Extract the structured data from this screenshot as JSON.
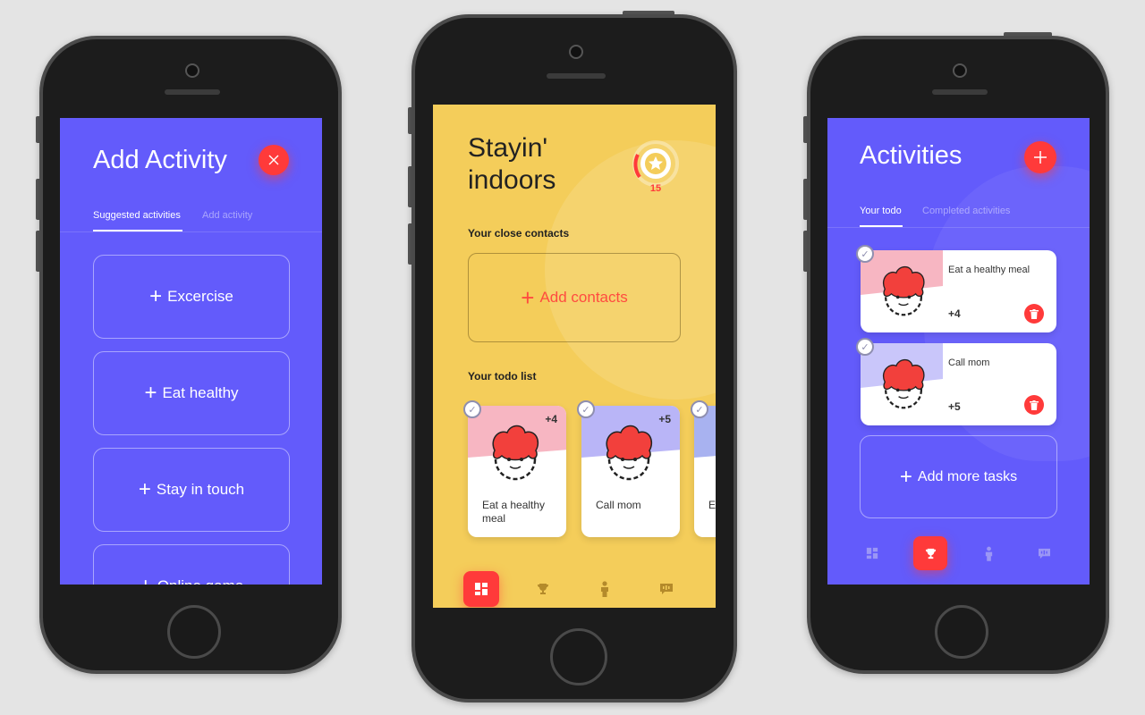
{
  "screens": {
    "add_activity": {
      "title": "Add Activity",
      "close_icon": "close-icon",
      "tabs": [
        {
          "label": "Suggested activities",
          "active": true
        },
        {
          "label": "Add activity",
          "active": false
        }
      ],
      "items": [
        {
          "label": "Excercise"
        },
        {
          "label": "Eat healthy"
        },
        {
          "label": "Stay in touch"
        },
        {
          "label": "Online game"
        }
      ]
    },
    "home": {
      "title_line1": "Stayin'",
      "title_line2": "indoors",
      "score": "15",
      "close_contacts_heading": "Your close contacts",
      "add_contacts_label": "Add contacts",
      "todo_heading": "Your todo list",
      "todo_cards": [
        {
          "label": "Eat a healthy meal",
          "points": "+4",
          "color": "#f7b6c2"
        },
        {
          "label": "Call mom",
          "points": "+5",
          "color": "#b9b5f7"
        },
        {
          "label": "Ea",
          "points": "",
          "color": "#b9b5f7"
        }
      ],
      "nav": [
        "dashboard-icon",
        "trophy-icon",
        "person-icon",
        "chat-icon"
      ],
      "active_nav": 0
    },
    "activities": {
      "title": "Activities",
      "tabs": [
        {
          "label": "Your todo",
          "active": true
        },
        {
          "label": "Completed activities",
          "active": false
        }
      ],
      "tasks": [
        {
          "label": "Eat a healthy meal",
          "points": "+4",
          "color": "#f7b6c2"
        },
        {
          "label": "Call mom",
          "points": "+5",
          "color": "#c9c6fa"
        }
      ],
      "add_more_label": "Add more tasks",
      "nav": [
        "dashboard-icon",
        "trophy-icon",
        "person-icon",
        "chat-icon"
      ],
      "active_nav": 1
    }
  },
  "colors": {
    "purple": "#635bfb",
    "yellow": "#f4cd5a",
    "red": "#ff3a3a"
  }
}
